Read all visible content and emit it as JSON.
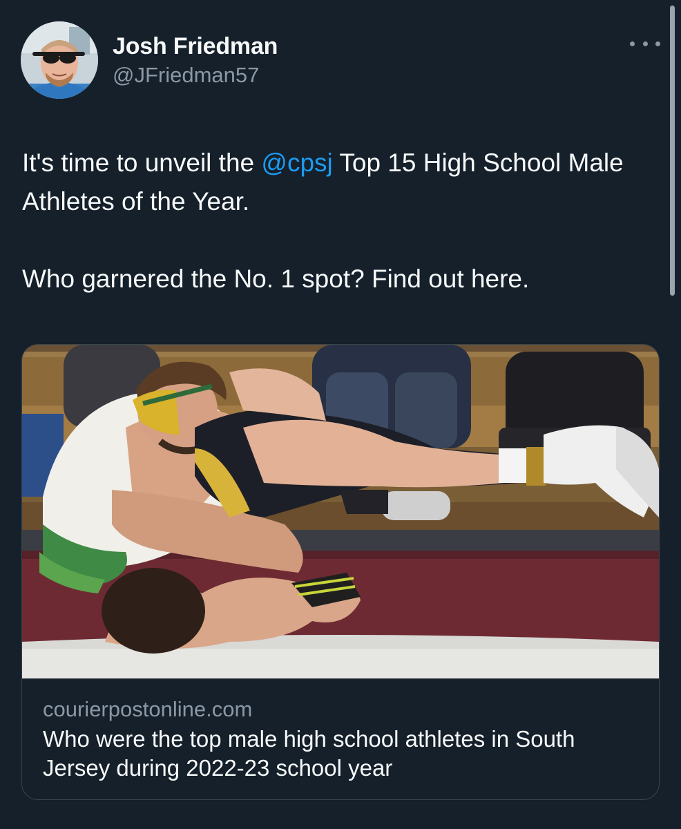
{
  "tweet": {
    "author": {
      "display_name": "Josh Friedman",
      "handle": "@JFriedman57"
    },
    "text": {
      "line1_prefix": "It's time to unveil the ",
      "mention": "@cpsj",
      "line1_suffix": " Top 15 High School Male Athletes of the Year.",
      "paragraph2": "Who garnered the No. 1 spot? Find out here."
    },
    "link_card": {
      "domain": "courierpostonline.com",
      "title": "Who were the top male high school athletes in South Jersey during 2022-23 school year",
      "image_icon": "wrestling-match-photo"
    },
    "more_icon": "ellipsis-icon"
  },
  "colors": {
    "background": "#15202b",
    "text_primary": "#f7f9f9",
    "text_secondary": "#8b98a5",
    "link": "#1d9bf0",
    "border": "#38444d"
  }
}
